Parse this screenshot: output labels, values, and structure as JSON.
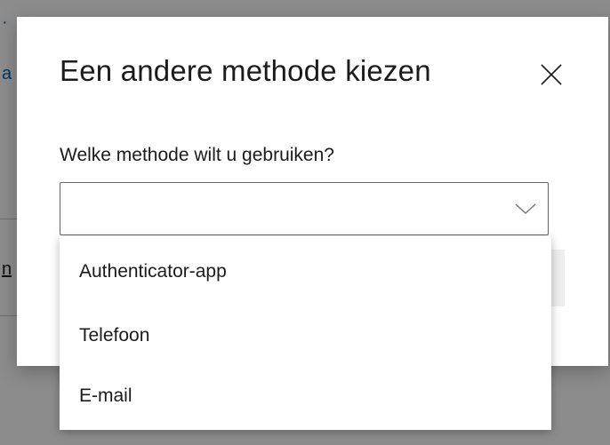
{
  "dialog": {
    "title": "Een andere methode kiezen",
    "close_icon": "close-icon",
    "field_label": "Welke methode wilt u gebruiken?",
    "select": {
      "value": "",
      "chevron_icon": "chevron-down-icon"
    }
  },
  "dropdown": {
    "options": [
      {
        "label": "Authenticator-app"
      },
      {
        "label": "Telefoon"
      },
      {
        "label": "E-mail"
      }
    ]
  },
  "colors": {
    "text": "#1b1b1b",
    "border": "#666666",
    "link": "#0067b8",
    "overlay": "#000000"
  }
}
